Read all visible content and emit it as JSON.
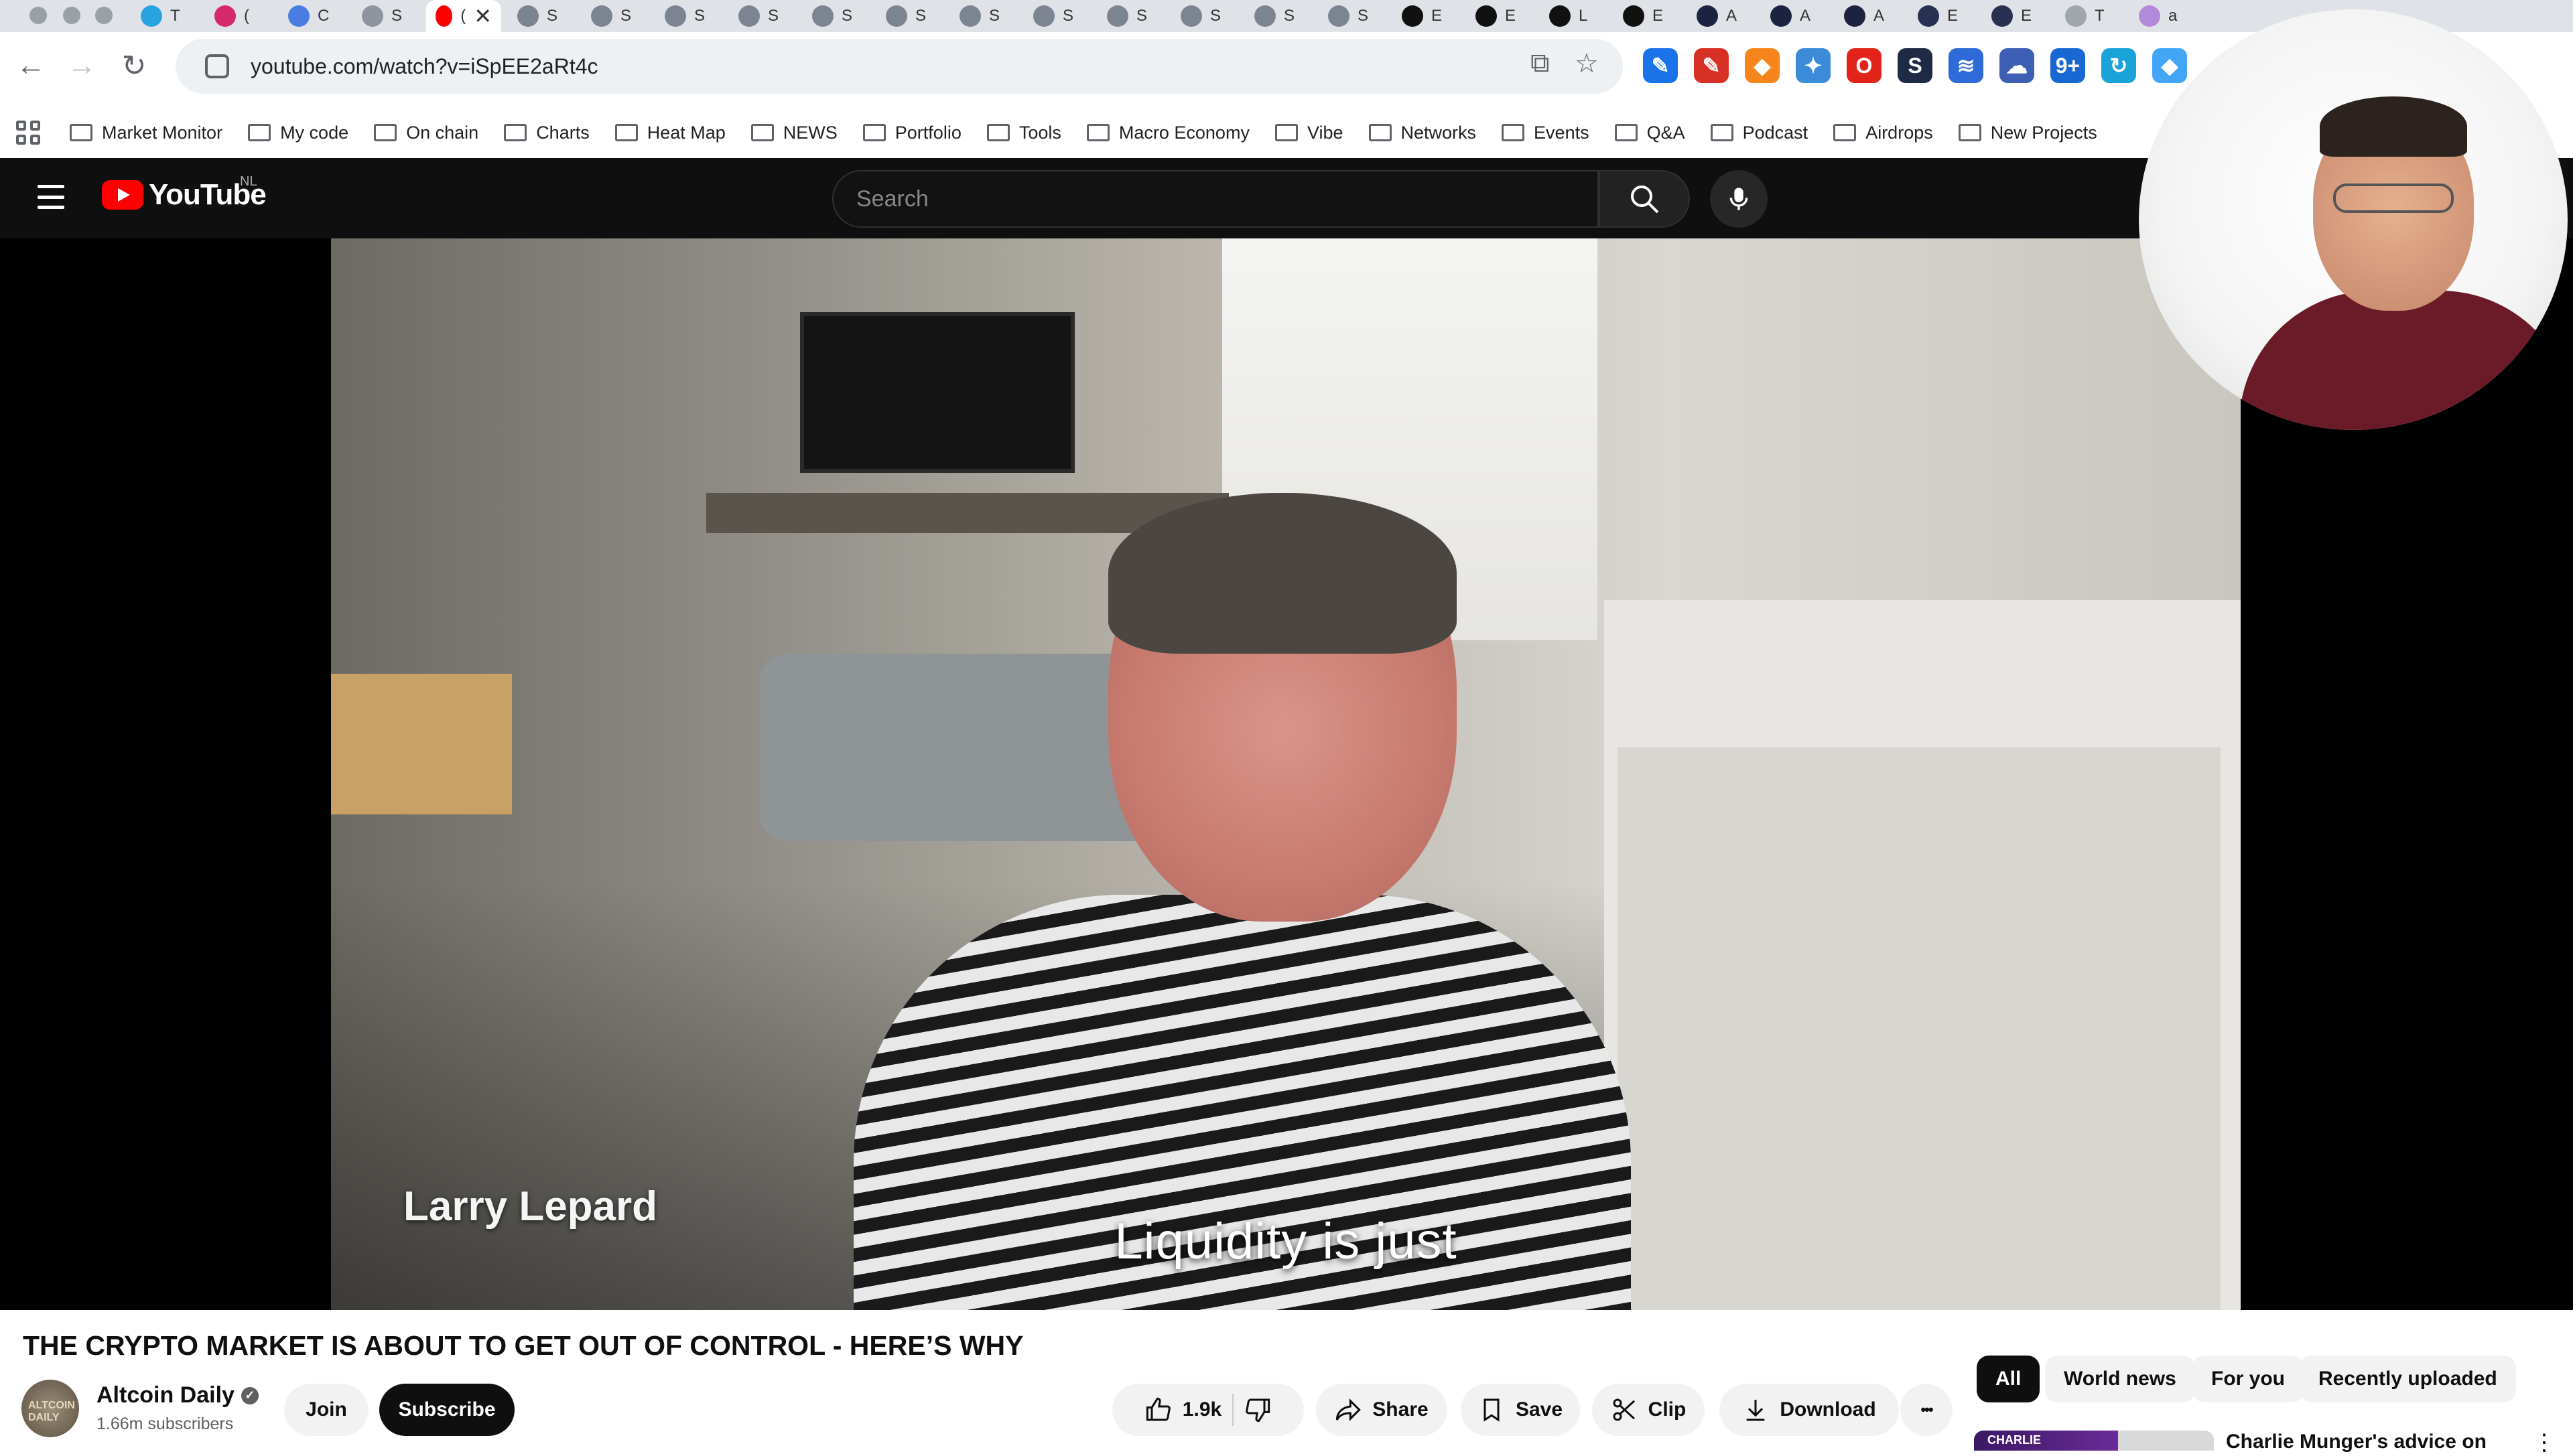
{
  "browser": {
    "tabs": [
      {
        "icon": "telegram-icon",
        "label": "T",
        "color": "#2aa3e0"
      },
      {
        "icon": "instagram-icon",
        "label": "(",
        "color": "#d6296b"
      },
      {
        "icon": "translate-icon",
        "label": "C",
        "color": "#4a7de2"
      },
      {
        "icon": "generic-icon",
        "label": "S",
        "color": "#8e959e"
      },
      {
        "icon": "youtube-icon",
        "label": "(",
        "active": true,
        "color": "#ff0000"
      },
      {
        "icon": "globe-icon",
        "label": "S"
      },
      {
        "icon": "globe-icon",
        "label": "S"
      },
      {
        "icon": "globe-icon",
        "label": "S"
      },
      {
        "icon": "globe-icon",
        "label": "S"
      },
      {
        "icon": "globe-icon",
        "label": "S"
      },
      {
        "icon": "globe-icon",
        "label": "S"
      },
      {
        "icon": "globe-icon",
        "label": "S"
      },
      {
        "icon": "globe-icon",
        "label": "S"
      },
      {
        "icon": "globe-icon",
        "label": "S"
      },
      {
        "icon": "globe-icon",
        "label": "S"
      },
      {
        "icon": "globe-icon",
        "label": "S"
      },
      {
        "icon": "globe-icon",
        "label": "S"
      },
      {
        "icon": "tradingview-icon",
        "label": "E",
        "color": "#111"
      },
      {
        "icon": "tradingview-icon",
        "label": "E",
        "color": "#111"
      },
      {
        "icon": "notion-icon",
        "label": "L",
        "color": "#111"
      },
      {
        "icon": "notion-icon",
        "label": "E",
        "color": "#111"
      },
      {
        "icon": "app-icon",
        "label": "A",
        "color": "#1c2340"
      },
      {
        "icon": "app-icon",
        "label": "A",
        "color": "#1c2340"
      },
      {
        "icon": "app-icon",
        "label": "A",
        "color": "#1c2340"
      },
      {
        "icon": "app-icon",
        "label": "E",
        "color": "#283152"
      },
      {
        "icon": "app-icon",
        "label": "E",
        "color": "#283152"
      },
      {
        "icon": "generic-icon",
        "label": "T",
        "color": "#a0a6ad"
      },
      {
        "icon": "generic-icon",
        "label": "a",
        "color": "#b28ad9"
      }
    ],
    "close_glyph": "✕",
    "url": "youtube.com/watch?v=iSpEE2aRt4c",
    "bookmarks": [
      "Market Monitor",
      "My code",
      "On chain",
      "Charts",
      "Heat Map",
      "NEWS",
      "Portfolio",
      "Tools",
      "Macro Economy",
      "Vibe",
      "Networks",
      "Events",
      "Q&A",
      "Podcast",
      "Airdrops",
      "New Projects"
    ],
    "extensions": [
      {
        "icon": "pen-icon",
        "color": "#1a73e8",
        "glyph": "✎"
      },
      {
        "icon": "red-pen-icon",
        "color": "#d93025",
        "glyph": "✎"
      },
      {
        "icon": "metamask-icon",
        "color": "#f6851b",
        "glyph": "◆"
      },
      {
        "icon": "extension-blue-icon",
        "color": "#3c8bd9",
        "glyph": "✦"
      },
      {
        "icon": "opera-icon",
        "color": "#e2231a",
        "glyph": "O"
      },
      {
        "icon": "s-extension-icon",
        "color": "#1f2a44",
        "glyph": "S"
      },
      {
        "icon": "layers-icon",
        "color": "#2f6bd8",
        "glyph": "≋"
      },
      {
        "icon": "cloud-icon",
        "color": "#3d5fb4",
        "glyph": "☁"
      },
      {
        "icon": "badge-extension-icon",
        "color": "#1967d2",
        "glyph": "9+"
      },
      {
        "icon": "refresh-extension-icon",
        "color": "#1aa3d9",
        "glyph": "↻"
      },
      {
        "icon": "diamond-icon",
        "color": "#42a5f5",
        "glyph": "◆"
      }
    ]
  },
  "youtube": {
    "logo_text": "YouTube",
    "country_code": "NL",
    "search_placeholder": "Search",
    "video": {
      "lower_third": "Larry Lepard",
      "caption": "Liquidity is just"
    },
    "title": "THE CRYPTO MARKET IS ABOUT TO GET OUT OF CONTROL - HERE’S WHY",
    "channel": {
      "name": "Altcoin Daily",
      "avatar_text": "ALTCOIN DAILY",
      "subscribers": "1.66m subscribers",
      "join_label": "Join",
      "subscribe_label": "Subscribe"
    },
    "actions": {
      "likes": "1.9k",
      "share_label": "Share",
      "save_label": "Save",
      "clip_label": "Clip",
      "download_label": "Download",
      "more_glyph": "•••"
    },
    "chips": [
      "All",
      "World news",
      "For you",
      "Recently uploaded"
    ],
    "recommended": {
      "thumb_text": "CHARLIE",
      "title": "Charlie Munger's advice on",
      "more_glyph": "⋮"
    }
  },
  "colors": {
    "youtube_red": "#ff0000",
    "header_bg": "#0f0f0f",
    "chip_active": "#0f0f0f"
  }
}
